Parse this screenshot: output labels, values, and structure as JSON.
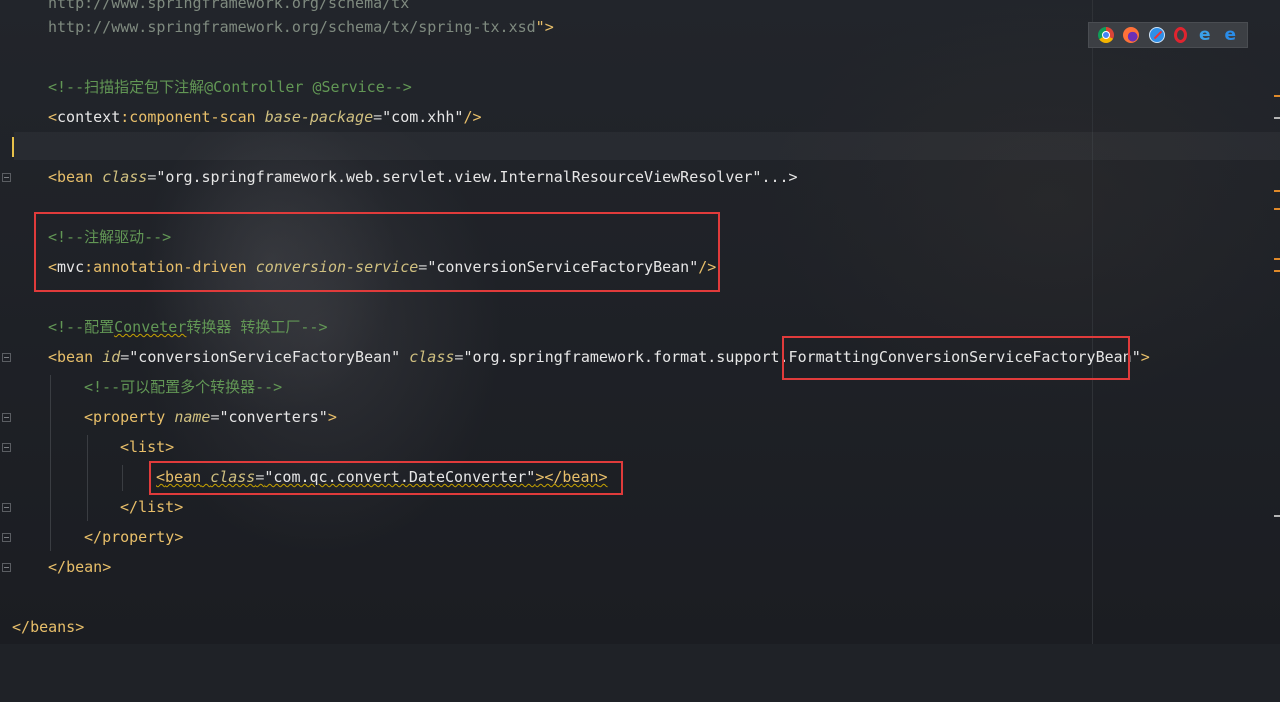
{
  "browser_icons": [
    "chrome-icon",
    "firefox-icon",
    "safari-icon",
    "opera-icon",
    "ie-icon",
    "edge-icon"
  ],
  "lines": {
    "l1": "http://www.springframework.org/schema/tx",
    "l2": "http://www.springframework.org/schema/tx/spring-tx.xsd",
    "l2_close": "\">",
    "l3_comment": "<!--扫描指定包下注解@Controller @Service-->",
    "l4": {
      "ns": "context",
      "name": "component-scan",
      "attr": "base-package",
      "value": "\"com.xhh\""
    },
    "l6": {
      "tag": "bean",
      "attr": "class",
      "value": "\"org.springframework.web.servlet.view.InternalResourceViewResolver\"",
      "rest": "...>"
    },
    "l7_comment": "<!--注解驱动-->",
    "l8": {
      "ns": "mvc",
      "name": "annotation-driven",
      "attr": "conversion-service",
      "value": "\"conversionServiceFactoryBean\""
    },
    "l9_comment_a": "<!--配置",
    "l9_comment_b": "Conveter",
    "l9_comment_c": "转换器 转换工厂-->",
    "l10": {
      "tag": "bean",
      "attr_id": "id",
      "value_id": "\"conversionServiceFactoryBean\"",
      "attr_class": "class",
      "value_class_a": "\"org.springframework.format.support.",
      "value_class_b": "FormattingConversionServiceFactoryBean",
      "value_class_c": "\""
    },
    "l11_comment": "<!--可以配置多个转换器-->",
    "l12": {
      "tag": "property",
      "attr": "name",
      "value": "\"converters\""
    },
    "l13_tag": "list",
    "l14": {
      "tag": "bean",
      "attr": "class",
      "value": "\"com.qc.convert.DateConverter\""
    },
    "l15_tag": "list",
    "l16_tag": "property",
    "l17_tag": "bean",
    "l19_tag": "beans"
  },
  "colors": {
    "comment": "#629755",
    "string": "#a5c25c",
    "highlight_box": "#e03b3b",
    "caret": "#e8c14a"
  }
}
